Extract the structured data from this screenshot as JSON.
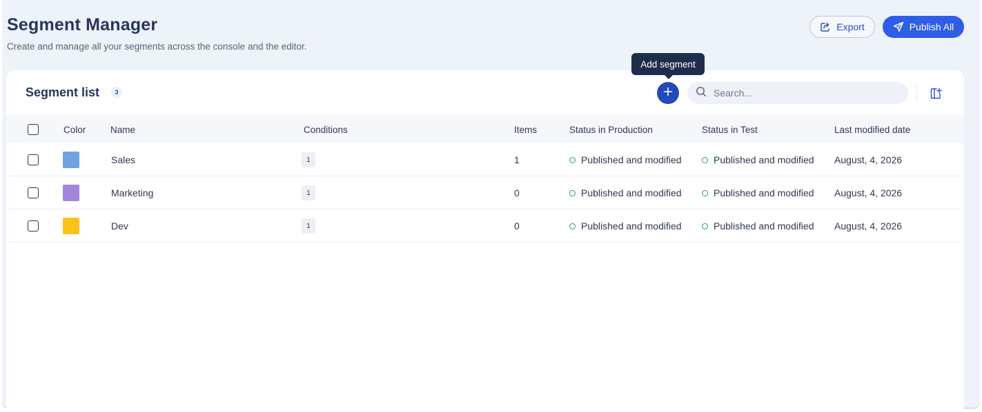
{
  "header": {
    "title": "Segment Manager",
    "subtitle": "Create and manage all your segments across the console and the editor.",
    "export_label": "Export",
    "export_icon": "export-icon",
    "publish_label": "Publish All",
    "publish_icon": "send-icon"
  },
  "list": {
    "title": "Segment list",
    "count": "3",
    "tooltip": "Add segment",
    "add_icon": "plus-icon",
    "search_placeholder": "Search...",
    "settings_icon": "column-settings-icon"
  },
  "table": {
    "columns": [
      "Color",
      "Name",
      "Conditions",
      "Items",
      "Status in Production",
      "Status in Test",
      "Last modified date"
    ],
    "rows": [
      {
        "color": "#6fa3e0",
        "name": "Sales",
        "conditions": "1",
        "items": "1",
        "status_production": "Published and modified",
        "status_test": "Published and modified",
        "modified": "August, 4, 2026"
      },
      {
        "color": "#a486dc",
        "name": "Marketing",
        "conditions": "1",
        "items": "0",
        "status_production": "Published and modified",
        "status_test": "Published and modified",
        "modified": "August, 4, 2026"
      },
      {
        "color": "#fbc21a",
        "name": "Dev",
        "conditions": "1",
        "items": "0",
        "status_production": "Published and modified",
        "status_test": "Published and modified",
        "modified": "August, 4, 2026"
      }
    ]
  },
  "colors": {
    "accent": "#2f5de6",
    "add_button": "#2348b8",
    "status_dot": "#1f9d6a",
    "background": "#eef2f9"
  }
}
